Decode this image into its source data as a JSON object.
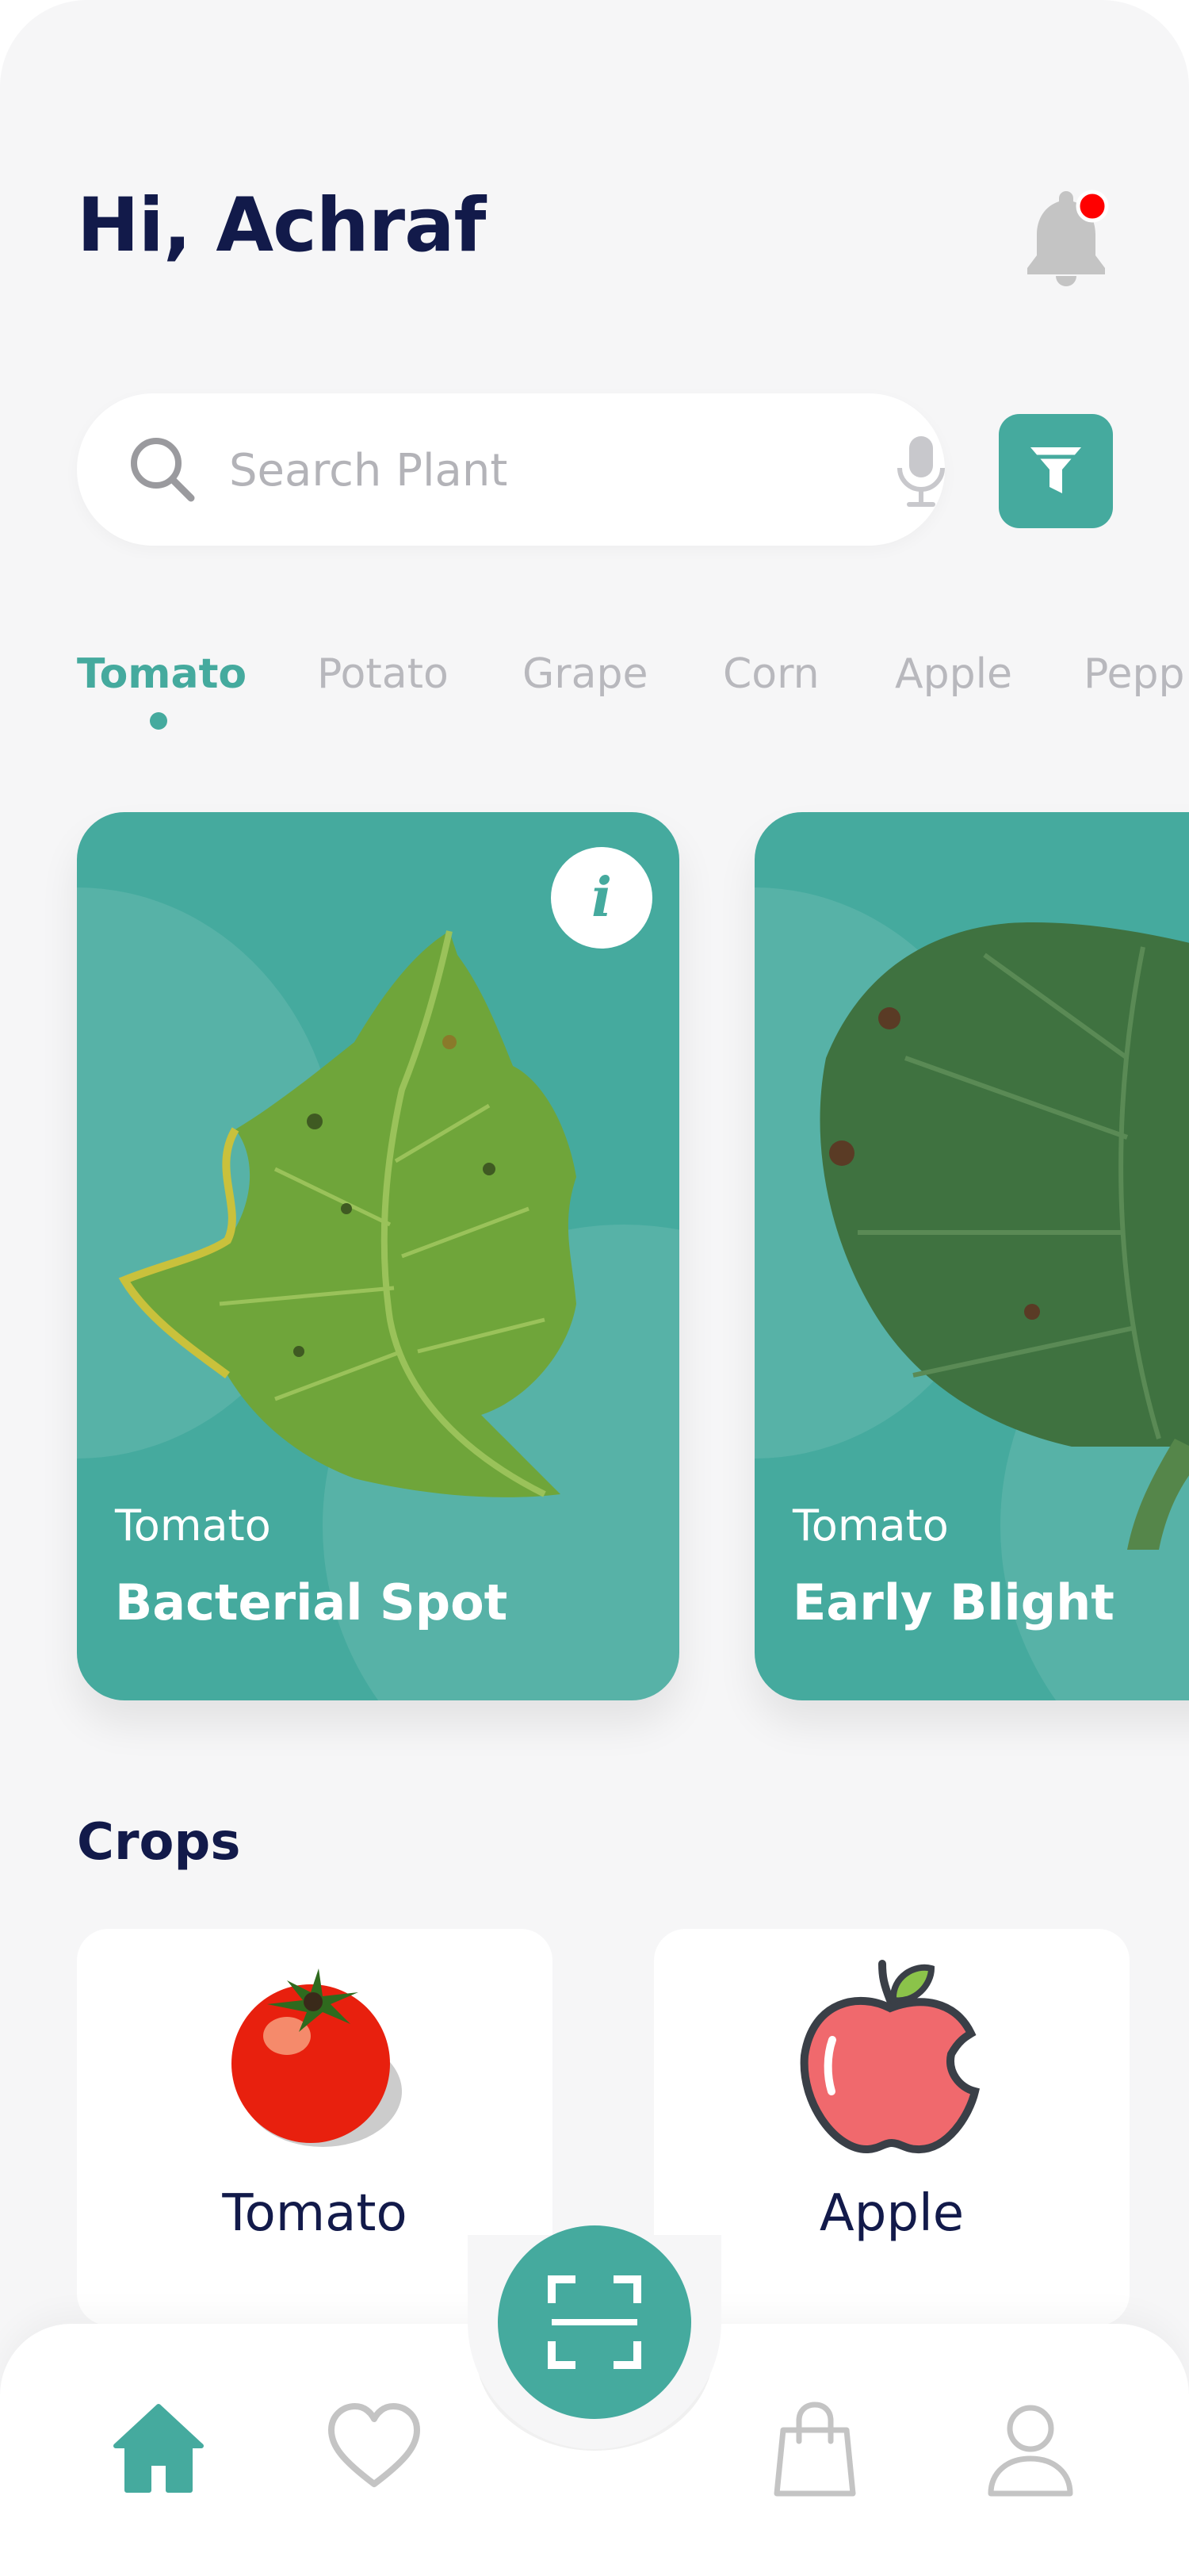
{
  "header": {
    "greeting": "Hi, Achraf",
    "has_notification": true
  },
  "search": {
    "placeholder": "Search Plant"
  },
  "categories": {
    "tabs": [
      "Tomato",
      "Potato",
      "Grape",
      "Corn",
      "Apple",
      "Pepp"
    ],
    "selected": "Tomato"
  },
  "disease_cards": [
    {
      "crop": "Tomato",
      "disease": "Bacterial Spot",
      "info_label": "i"
    },
    {
      "crop": "Tomato",
      "disease": "Early Blight"
    }
  ],
  "crops_section": {
    "title": "Crops",
    "items": [
      {
        "label": "Tomato",
        "icon": "tomato-icon"
      },
      {
        "label": "Apple",
        "icon": "apple-icon"
      }
    ]
  },
  "bottom_nav": {
    "items": [
      "home-icon",
      "heart-icon",
      "scan-icon",
      "bag-icon",
      "profile-icon"
    ],
    "active": "home-icon"
  },
  "colors": {
    "accent": "#45aa9e",
    "title": "#121a4a",
    "background": "#f6f6f7",
    "notification_dot": "#ff0000"
  }
}
